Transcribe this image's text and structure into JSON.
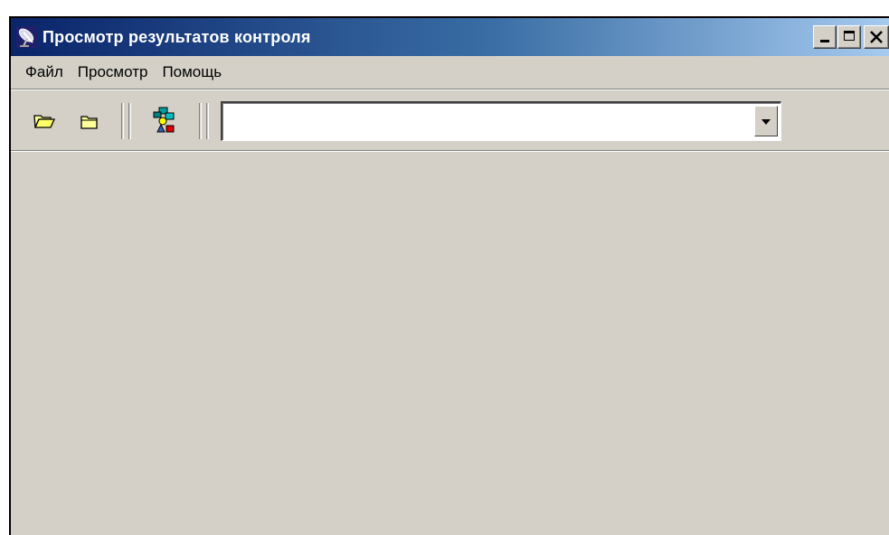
{
  "window": {
    "title": "Просмотр результатов контроля"
  },
  "titlebar_buttons": {
    "minimize_icon": "minimize-icon",
    "maximize_icon": "maximize-icon",
    "close_icon": "close-icon"
  },
  "menu": {
    "items": [
      {
        "label": "Файл"
      },
      {
        "label": "Просмотр"
      },
      {
        "label": "Помощь"
      }
    ]
  },
  "toolbar": {
    "buttons": [
      {
        "icon": "open-folder-icon"
      },
      {
        "icon": "folder-icon"
      },
      {
        "icon": "network-icon"
      }
    ],
    "combo": {
      "value": ""
    }
  },
  "colors": {
    "titlebar_start": "#0a246a",
    "titlebar_end": "#a6caf0",
    "face": "#d4d0c8"
  }
}
